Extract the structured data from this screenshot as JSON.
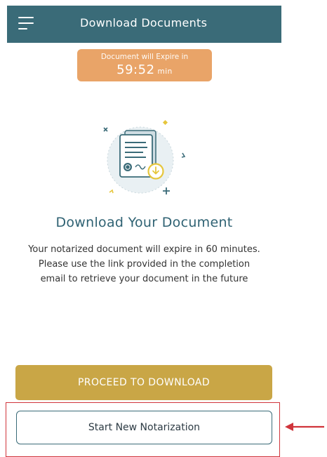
{
  "header": {
    "title": "Download Documents"
  },
  "expiry": {
    "label": "Document will Expire in",
    "time": "59:52",
    "unit": "min"
  },
  "main": {
    "title": "Download Your Document",
    "description": "Your notarized document will expire in 60 minutes. Please use the link provided in the completion email to retrieve your document in the future"
  },
  "buttons": {
    "proceed": "PROCEED TO DOWNLOAD",
    "new_notarization": "Start New Notarization"
  },
  "icons": {
    "menu": "hamburger-menu-icon",
    "illustration": "document-download-icon",
    "annotation": "red-arrow-icon"
  },
  "colors": {
    "header": "#3a6b78",
    "expiry": "#e9a468",
    "gold_button": "#c9a646",
    "title_text": "#2f6273",
    "highlight": "#d0343b"
  }
}
